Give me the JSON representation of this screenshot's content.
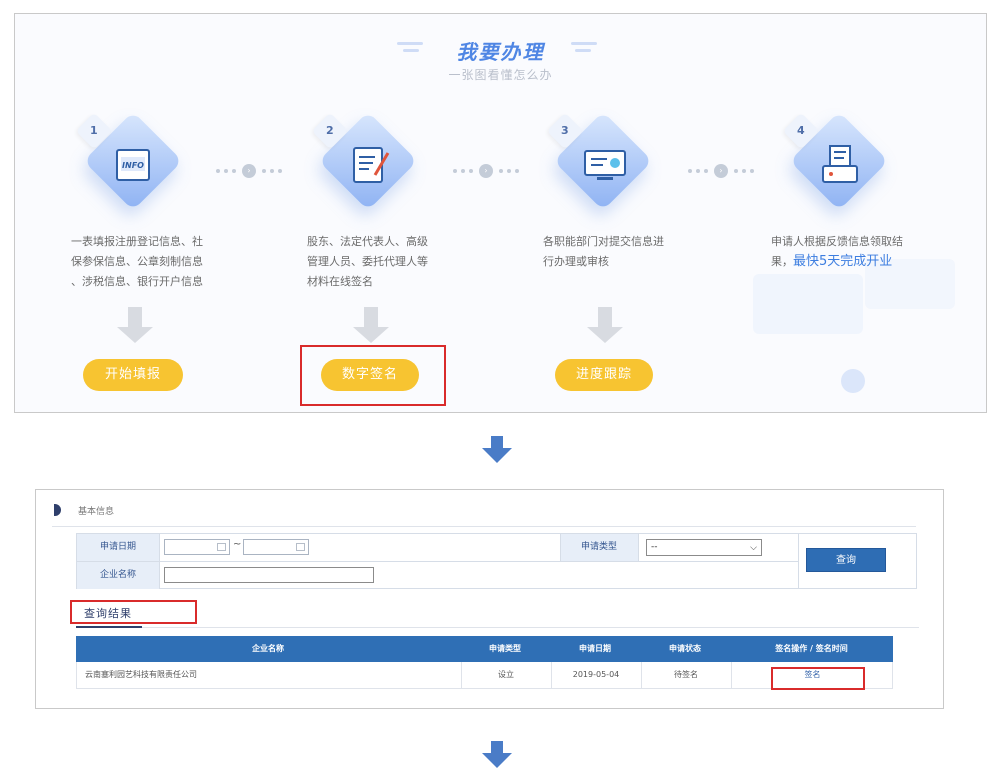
{
  "flow": {
    "title": "我要办理",
    "subtitle": "一张图看懂怎么办",
    "steps": [
      {
        "number": "1",
        "icon": "info-form-icon",
        "desc_lines": [
          "一表填报注册登记信息、社",
          "保参保信息、公章刻制信息",
          "、涉税信息、银行开户信息"
        ],
        "button": "开始填报"
      },
      {
        "number": "2",
        "icon": "document-sign-icon",
        "desc_lines": [
          "股东、法定代表人、高级",
          "管理人员、委托代理人等",
          "材料在线签名"
        ],
        "button": "数字签名"
      },
      {
        "number": "3",
        "icon": "monitor-review-icon",
        "desc_lines": [
          "各职能部门对提交信息进",
          "行办理或审核"
        ],
        "button": "进度跟踪"
      },
      {
        "number": "4",
        "icon": "printer-result-icon",
        "desc_lines": [
          "申请人根据反馈信息领取结"
        ],
        "desc_last_prefix": "果，",
        "desc_highlight": "最快5天完成开业"
      }
    ]
  },
  "form": {
    "section_title": "基本信息",
    "apply_date_label": "申请日期",
    "date_separator": "~",
    "company_name_label": "企业名称",
    "apply_type_label": "申请类型",
    "apply_type_selected": "--",
    "query_button": "查询",
    "result_tab": "查询结果"
  },
  "table": {
    "columns": [
      "企业名称",
      "申请类型",
      "申请日期",
      "申请状态",
      "签名操作 / 签名时间"
    ],
    "rows": [
      {
        "company": "云南塞利园艺科技有限责任公司",
        "type": "设立",
        "date": "2019-05-04",
        "status": "待签名",
        "action": "签名"
      }
    ]
  },
  "colors": {
    "accent_blue": "#2f6fb5",
    "pill_yellow": "#f7c431",
    "highlight_red": "#d92b2b"
  }
}
